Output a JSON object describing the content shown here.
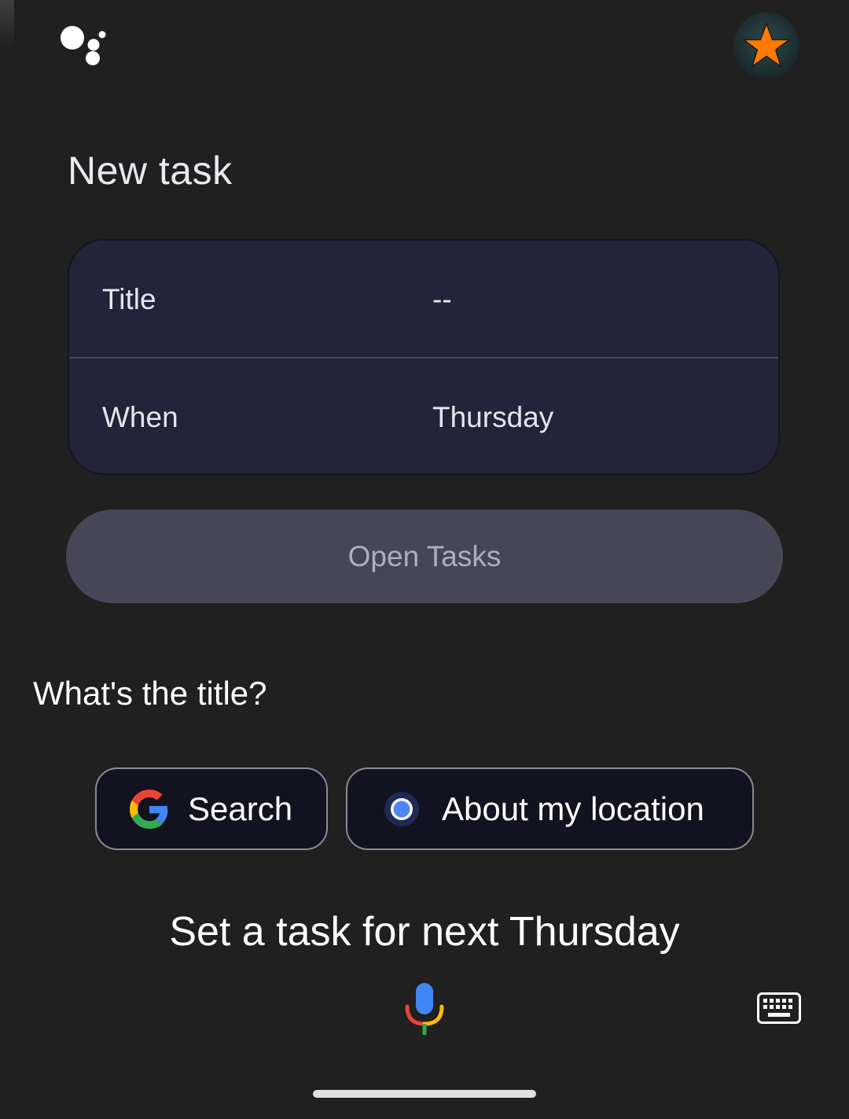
{
  "card_title": "New task",
  "fields": [
    {
      "label": "Title",
      "value": "--"
    },
    {
      "label": "When",
      "value": "Thursday"
    }
  ],
  "open_button_label": "Open Tasks",
  "prompt": "What's the title?",
  "chips": [
    {
      "label": "Search",
      "icon": "google-g-icon"
    },
    {
      "label": "About my location",
      "icon": "location-dot-icon"
    }
  ],
  "query_text": "Set a task for next Thursday",
  "icons": {
    "assistant": "google-assistant-icon",
    "avatar": "star-avatar-icon",
    "mic": "mic-icon",
    "keyboard": "keyboard-icon"
  },
  "colors": {
    "background": "#202020",
    "card": "#23233a",
    "button": "#474657",
    "chip": "#121220",
    "avatar_star": "#ff7a00"
  }
}
